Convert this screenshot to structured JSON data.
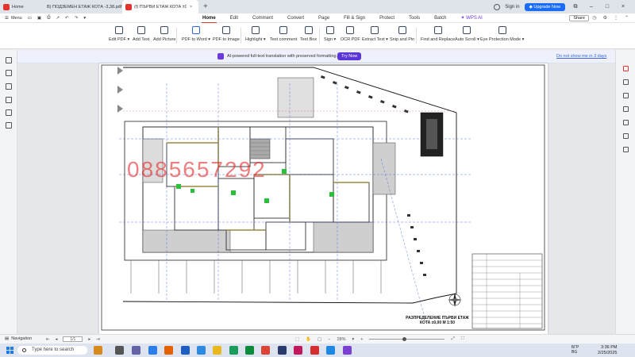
{
  "tabs": [
    {
      "label": "Home",
      "type": "home"
    },
    {
      "label": "В) ПОДЗЕМЕН ЕТАЖ КОТА -3,38.pdf",
      "type": "pdf"
    },
    {
      "label": "(f) ПЪРВИ ЕТАЖ КОТА ±0,00...",
      "type": "pdf-active"
    }
  ],
  "titlebar": {
    "sign_in": "Sign in",
    "upgrade": "Upgrade Now"
  },
  "menu": {
    "left": "Menu",
    "tabs": [
      "Home",
      "Edit",
      "Comment",
      "Convert",
      "Page",
      "Fill & Sign",
      "Protect",
      "Tools",
      "Batch"
    ],
    "active_tab": "Home",
    "wps_ai": "WPS AI",
    "share": "Share"
  },
  "toolbar": [
    "Edit PDF",
    "Add Text",
    "Add Picture",
    "PDF to Word",
    "PDF to Image",
    "Highlight",
    "Text comment",
    "Text Box",
    "Sign",
    "OCR PDF",
    "Extract Text",
    "Snip and Pin",
    "Find and Replace",
    "Auto Scroll",
    "Eye Protection Mode"
  ],
  "banner": {
    "text": "AI-powered full-text translation with preserved formatting.",
    "button": "Try Now",
    "dismiss": "Do not show me in 3 days"
  },
  "document": {
    "watermark": "0885657292",
    "title_block": "РАЗПРЕДЕЛЕНИЕ ПЪРВИ ЕТАЖ\nКОТА ±0,00 М 1:50"
  },
  "statusbar": {
    "navigation": "Navigation",
    "page": "1/1",
    "zoom": "28%"
  },
  "taskbar": {
    "search_placeholder": "Type here to search",
    "lang": "БГР",
    "region": "BG",
    "time": "3:36 PM",
    "date": "2/25/2025"
  }
}
